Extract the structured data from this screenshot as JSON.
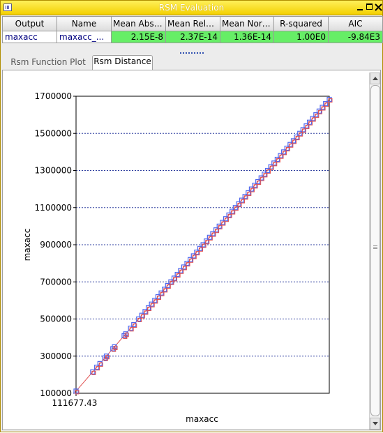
{
  "window": {
    "title": "RSM Evaluation"
  },
  "table": {
    "headers": [
      "Output",
      "Name",
      "Mean Absol...",
      "Mean Relati...",
      "Mean Norm...",
      "R-squared",
      "AIC"
    ],
    "rows": [
      [
        "maxacc",
        "maxacc_...",
        "2.15E-8",
        "2.37E-14",
        "1.36E-14",
        "1.00E0",
        "-9.84E3"
      ]
    ]
  },
  "tabs": [
    {
      "label": "Rsm Function Plot",
      "active": false
    },
    {
      "label": "Rsm Distance",
      "active": true
    }
  ],
  "colors": {
    "title_bar": "#f3d000",
    "good_cell": "#66ee66",
    "marker_blue": "#5068ee",
    "marker_red": "#e05050",
    "grid_line": "#3040a0"
  },
  "chart_data": {
    "type": "scatter",
    "xlabel": "maxacc",
    "ylabel": "maxacc",
    "x_tick_labels": [
      "111677.43"
    ],
    "y_tick_labels": [
      "100000",
      "300000",
      "500000",
      "700000",
      "900000",
      "1100000",
      "1300000",
      "1500000",
      "1700000"
    ],
    "xlim": [
      111677.43,
      1683000
    ],
    "ylim": [
      100000,
      1700000
    ],
    "grid": "horizontal dashed",
    "series": [
      {
        "marker": "square",
        "x": [
          111677,
          215000,
          240000,
          260000,
          290000,
          300000,
          340000,
          350000,
          410000,
          420000,
          450000,
          470000,
          500000,
          520000,
          540000,
          560000,
          580000,
          600000,
          620000,
          640000,
          660000,
          680000,
          700000,
          720000,
          740000,
          760000,
          780000,
          800000,
          820000,
          840000,
          860000,
          880000,
          900000,
          920000,
          940000,
          960000,
          980000,
          1000000,
          1020000,
          1040000,
          1060000,
          1080000,
          1100000,
          1120000,
          1140000,
          1160000,
          1180000,
          1200000,
          1220000,
          1240000,
          1260000,
          1280000,
          1300000,
          1320000,
          1340000,
          1360000,
          1380000,
          1400000,
          1420000,
          1440000,
          1460000,
          1480000,
          1500000,
          1520000,
          1540000,
          1560000,
          1580000,
          1600000,
          1620000,
          1640000,
          1660000,
          1683000
        ],
        "y": [
          111677,
          215000,
          240000,
          260000,
          290000,
          300000,
          340000,
          350000,
          410000,
          420000,
          450000,
          470000,
          500000,
          520000,
          540000,
          560000,
          580000,
          600000,
          620000,
          640000,
          660000,
          680000,
          700000,
          720000,
          740000,
          760000,
          780000,
          800000,
          820000,
          840000,
          860000,
          880000,
          900000,
          920000,
          940000,
          960000,
          980000,
          1000000,
          1020000,
          1040000,
          1060000,
          1080000,
          1100000,
          1120000,
          1140000,
          1160000,
          1180000,
          1200000,
          1220000,
          1240000,
          1260000,
          1280000,
          1300000,
          1320000,
          1340000,
          1360000,
          1380000,
          1400000,
          1420000,
          1440000,
          1460000,
          1480000,
          1500000,
          1520000,
          1540000,
          1560000,
          1580000,
          1600000,
          1620000,
          1640000,
          1660000,
          1683000
        ]
      },
      {
        "type": "line",
        "x": [
          111677.43,
          1683000
        ],
        "y": [
          111677.43,
          1683000
        ]
      }
    ]
  }
}
